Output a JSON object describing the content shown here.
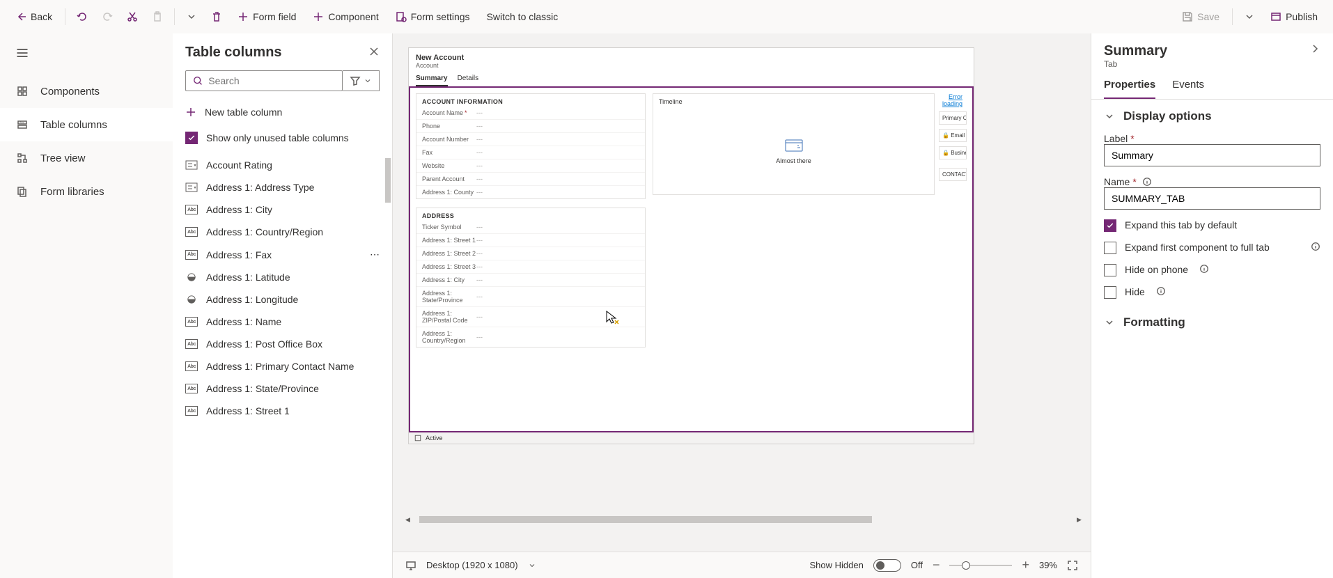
{
  "cmdbar": {
    "back": "Back",
    "form_field": "Form field",
    "component": "Component",
    "form_settings": "Form settings",
    "switch_classic": "Switch to classic",
    "save": "Save",
    "publish": "Publish"
  },
  "rail": {
    "components": "Components",
    "table_columns": "Table columns",
    "tree_view": "Tree view",
    "form_libraries": "Form libraries"
  },
  "tcol": {
    "title": "Table columns",
    "search_placeholder": "Search",
    "new_col": "New table column",
    "unused": "Show only unused table columns",
    "items": [
      {
        "label": "Account Rating",
        "type": "option"
      },
      {
        "label": "Address 1: Address Type",
        "type": "option"
      },
      {
        "label": "Address 1: City",
        "type": "text"
      },
      {
        "label": "Address 1: Country/Region",
        "type": "text"
      },
      {
        "label": "Address 1: Fax",
        "type": "text"
      },
      {
        "label": "Address 1: Latitude",
        "type": "globe"
      },
      {
        "label": "Address 1: Longitude",
        "type": "globe"
      },
      {
        "label": "Address 1: Name",
        "type": "text"
      },
      {
        "label": "Address 1: Post Office Box",
        "type": "text"
      },
      {
        "label": "Address 1: Primary Contact Name",
        "type": "text"
      },
      {
        "label": "Address 1: State/Province",
        "type": "text"
      },
      {
        "label": "Address 1: Street 1",
        "type": "text"
      }
    ]
  },
  "preview": {
    "title": "New Account",
    "subtitle": "Account",
    "tabs": {
      "summary": "Summary",
      "details": "Details"
    },
    "sec_account_info": "ACCOUNT INFORMATION",
    "sec_address": "ADDRESS",
    "timeline": "Timeline",
    "almost_there": "Almost there",
    "error_loading": "Error loading",
    "primary_co": "Primary Co",
    "email": "Email",
    "business": "Business",
    "contacts": "CONTACTS",
    "status": "Active",
    "fields_info": [
      {
        "label": "Account Name",
        "req": true
      },
      {
        "label": "Phone"
      },
      {
        "label": "Account Number"
      },
      {
        "label": "Fax"
      },
      {
        "label": "Website"
      },
      {
        "label": "Parent Account"
      },
      {
        "label": "Address 1: County"
      }
    ],
    "fields_addr": [
      {
        "label": "Ticker Symbol"
      },
      {
        "label": "Address 1: Street 1"
      },
      {
        "label": "Address 1: Street 2"
      },
      {
        "label": "Address 1: Street 3"
      },
      {
        "label": "Address 1: City"
      },
      {
        "label": "Address 1: State/Province"
      },
      {
        "label": "Address 1: ZIP/Postal Code"
      },
      {
        "label": "Address 1: Country/Region"
      }
    ]
  },
  "footer": {
    "viewport": "Desktop (1920 x 1080)",
    "show_hidden": "Show Hidden",
    "off": "Off",
    "zoom": "39%"
  },
  "pp": {
    "title": "Summary",
    "subtitle": "Tab",
    "tab_props": "Properties",
    "tab_events": "Events",
    "grp_display": "Display options",
    "lbl_label": "Label",
    "val_label": "Summary",
    "lbl_name": "Name",
    "val_name": "SUMMARY_TAB",
    "chk_expand_default": "Expand this tab by default",
    "chk_expand_first": "Expand first component to full tab",
    "chk_hide_phone": "Hide on phone",
    "chk_hide": "Hide",
    "grp_formatting": "Formatting"
  }
}
